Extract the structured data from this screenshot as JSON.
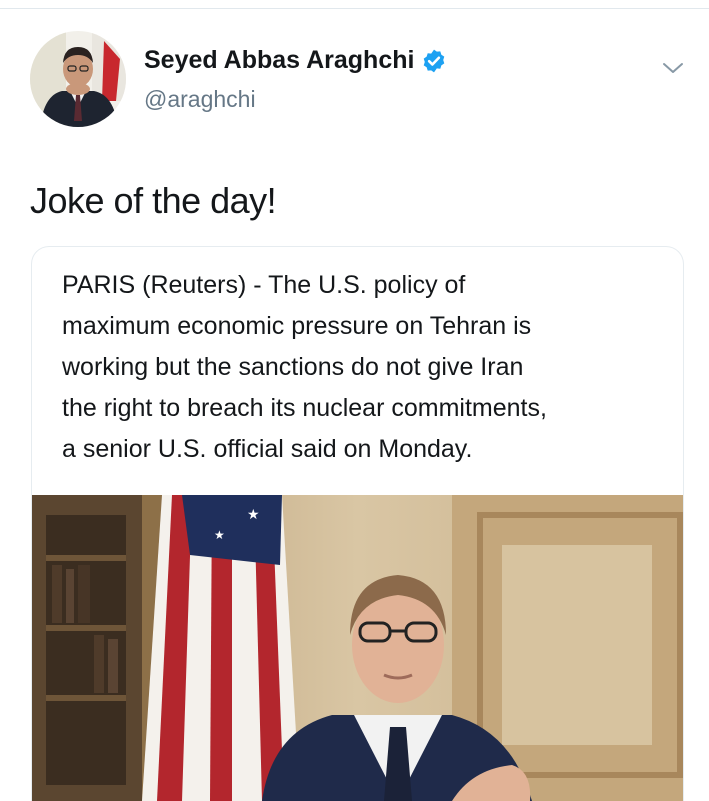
{
  "tweet": {
    "author": {
      "display_name": "Seyed Abbas Araghchi",
      "handle": "@araghchi",
      "verified": true,
      "avatar_icon": "profile-photo"
    },
    "menu_icon": "chevron-down-icon",
    "text": "Joke of the day!"
  },
  "card": {
    "lines": [
      "PARIS (Reuters) - The U.S. policy of",
      "maximum economic pressure on Tehran is",
      "working but the sanctions do not give Iran",
      "the right to breach its nuclear commitments,",
      "a senior U.S. official said on Monday."
    ],
    "image": "photo of official speaking in front of a U.S. flag"
  },
  "colors": {
    "verified_blue": "#1da1f2",
    "handle_gray": "#657786",
    "text": "#14171a",
    "border": "#e6ecf0"
  }
}
